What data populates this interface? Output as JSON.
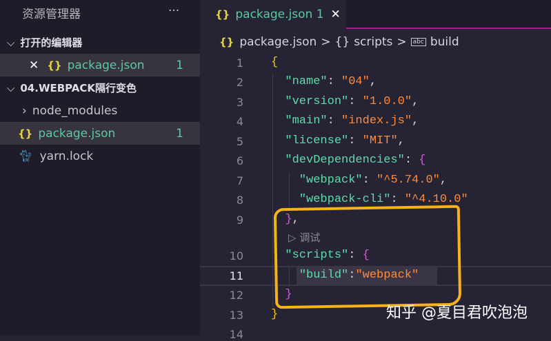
{
  "sidebar": {
    "title": "资源管理器",
    "more": "···",
    "open_editors": "打开的编辑器",
    "open_file": "package.json",
    "open_badge": "1",
    "project": "04.WEBPACK隔行变色",
    "items": [
      {
        "label": "node_modules"
      },
      {
        "label": "package.json",
        "badge": "1"
      },
      {
        "label": "yarn.lock"
      }
    ]
  },
  "tab": {
    "label": "package.json",
    "badge": "1",
    "close": "✕"
  },
  "breadcrumb": {
    "file": "package.json",
    "scripts": "scripts",
    "build": "build",
    "sep": ">"
  },
  "codelens": "调试",
  "lines": [
    "1",
    "2",
    "3",
    "4",
    "5",
    "6",
    "7",
    "8",
    "9",
    "10",
    "11",
    "12",
    "13",
    "14"
  ],
  "code": {
    "name_k": "\"name\"",
    "name_v": "\"04\"",
    "version_k": "\"version\"",
    "version_v": "\"1.0.0\"",
    "main_k": "\"main\"",
    "main_v": "\"index.js\"",
    "license_k": "\"license\"",
    "license_v": "\"MIT\"",
    "dev_k": "\"devDependencies\"",
    "webpack_k": "\"webpack\"",
    "webpack_v": "\"^5.74.0\"",
    "cli_k": "\"webpack-cli\"",
    "cli_v": "\"^4.10.0\"",
    "scripts_k": "\"scripts\"",
    "build_k": "\"build\"",
    "build_v": "\"webpack\""
  },
  "watermark": "知乎 @夏目君吹泡泡"
}
